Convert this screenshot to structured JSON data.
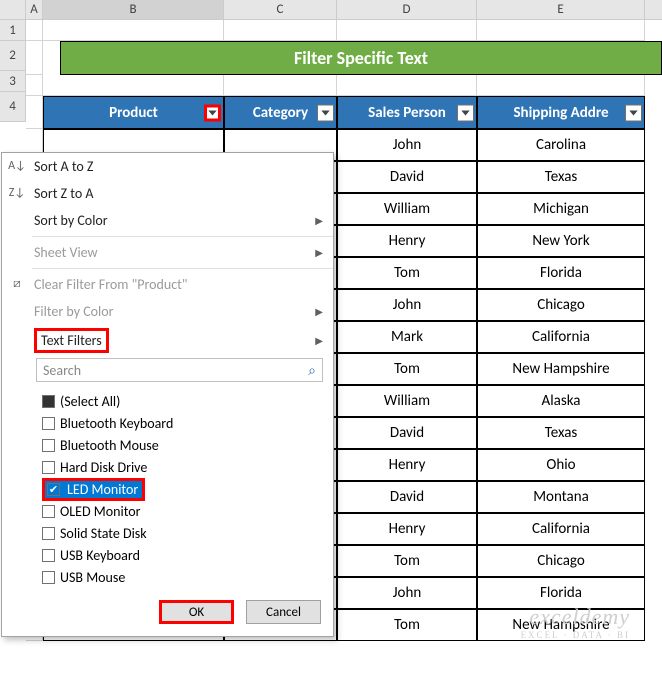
{
  "col_headers": [
    "A",
    "B",
    "C",
    "D",
    "E"
  ],
  "row_headers": [
    "1",
    "2",
    "3",
    "4"
  ],
  "title": "Filter Specific Text",
  "headers": {
    "product": "Product",
    "category": "Category",
    "sales_person": "Sales Person",
    "shipping": "Shipping Addre"
  },
  "rows": [
    {
      "sales": "John",
      "ship": "Carolina"
    },
    {
      "sales": "David",
      "ship": "Texas"
    },
    {
      "sales": "William",
      "ship": "Michigan"
    },
    {
      "sales": "Henry",
      "ship": "New York"
    },
    {
      "sales": "Tom",
      "ship": "Florida"
    },
    {
      "sales": "John",
      "ship": "Chicago"
    },
    {
      "sales": "Mark",
      "ship": "California"
    },
    {
      "sales": "Tom",
      "ship": "New Hampshire"
    },
    {
      "sales": "William",
      "ship": "Alaska"
    },
    {
      "sales": "David",
      "ship": "Texas"
    },
    {
      "sales": "Henry",
      "ship": "Ohio"
    },
    {
      "sales": "David",
      "ship": "Montana"
    },
    {
      "sales": "Henry",
      "ship": "California"
    },
    {
      "sales": "Tom",
      "ship": "Chicago"
    },
    {
      "sales": "John",
      "ship": "Florida"
    },
    {
      "sales": "Tom",
      "ship": "New Hampshire"
    }
  ],
  "dropdown": {
    "sort_az": "Sort A to Z",
    "sort_za": "Sort Z to A",
    "sort_color": "Sort by Color",
    "sheet_view": "Sheet View",
    "clear_filter": "Clear Filter From \"Product\"",
    "filter_color": "Filter by Color",
    "text_filters": "Text Filters",
    "search_placeholder": "Search",
    "items": [
      {
        "label": "(Select All)",
        "checked": false,
        "filled": true
      },
      {
        "label": "Bluetooth Keyboard",
        "checked": false
      },
      {
        "label": "Bluetooth Mouse",
        "checked": false
      },
      {
        "label": "Hard Disk Drive",
        "checked": false
      },
      {
        "label": "LED Monitor",
        "checked": true,
        "highlight": true
      },
      {
        "label": "OLED Monitor",
        "checked": false
      },
      {
        "label": "Solid State Disk",
        "checked": false
      },
      {
        "label": "USB Keyboard",
        "checked": false
      },
      {
        "label": "USB Mouse",
        "checked": false
      }
    ],
    "ok": "OK",
    "cancel": "Cancel"
  },
  "watermark": {
    "line1": "exceldemy",
    "line2": "EXCEL · DATA · BI"
  }
}
